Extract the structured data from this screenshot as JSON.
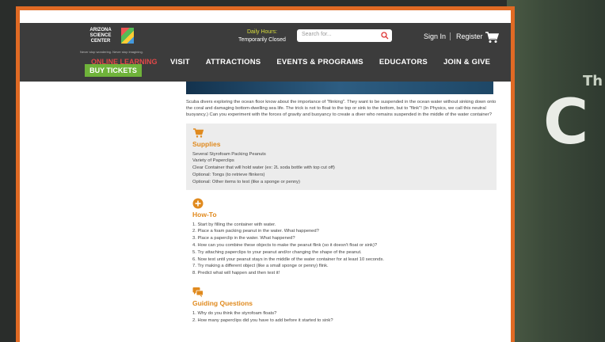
{
  "site": {
    "logo_text": "ARIZONA SCIENCE CENTER",
    "logo_tag": "Never stop wondering. Never stop imagining.",
    "online_learning": "ONLINE LEARNING",
    "buy_tickets": "BUY TICKETS",
    "hours_label": "Daily Hours:",
    "hours_value": "Temporarily Closed",
    "search_placeholder": "Search for...",
    "sign_in": "Sign In",
    "register": "Register",
    "nav": [
      "VISIT",
      "ATTRACTIONS",
      "EVENTS & PROGRAMS",
      "EDUCATORS",
      "JOIN & GIVE"
    ]
  },
  "article": {
    "intro": "Scuba divers exploring the ocean floor know about the importance of \"flinking\". They want to be suspended in the ocean water without sinking down onto the coral and damaging bottom-dwelling sea life. The trick is not to float to the top or sink to the bottom, but to \"flink\"! (In Physics, we call this neutral buoyancy.) Can you experiment with the forces of gravity and buoyancy to create a diver who remains suspended in the middle of the water container?",
    "supplies_title": "Supplies",
    "supplies": [
      "Several Styrofoam Packing Peanuts",
      "Variety of Paperclips",
      "Clear Container that will hold water (ex: 2L soda bottle with top cut off)",
      "Optional: Tongs (to retrieve flinkers)",
      "Optional: Other items to test (like a sponge or penny)"
    ],
    "howto_title": "How-To",
    "howto": [
      "1. Start by filling the container with water.",
      "2. Place a foam packing peanut in the water. What happened?",
      "3. Place a paperclip in the water. What happened?",
      "4. How can you combine these objects to make the peanut flink (so it doesn't float or sink)?",
      "5. Try attaching paperclips to your peanut and/or changing the shape of the peanut.",
      "6. Now test until your peanut stays in the middle of the water container for at least 10 seconds.",
      "7. Try making a different object (like a small sponge or penny) flink.",
      "8. Predict what will happen and then test it!"
    ],
    "guiding_title": "Guiding Questions",
    "guiding": [
      "1. Why do you think the styrofoam floats?",
      "2. How many paperclips did you have to add before it started to sink?"
    ]
  },
  "background": {
    "letters_small": "Th",
    "letter_big": "C"
  },
  "colors": {
    "frame": "#e06a24",
    "header": "#3c3c3c",
    "accent_orange": "#e08a1e",
    "buy_green": "#6fb33a"
  }
}
